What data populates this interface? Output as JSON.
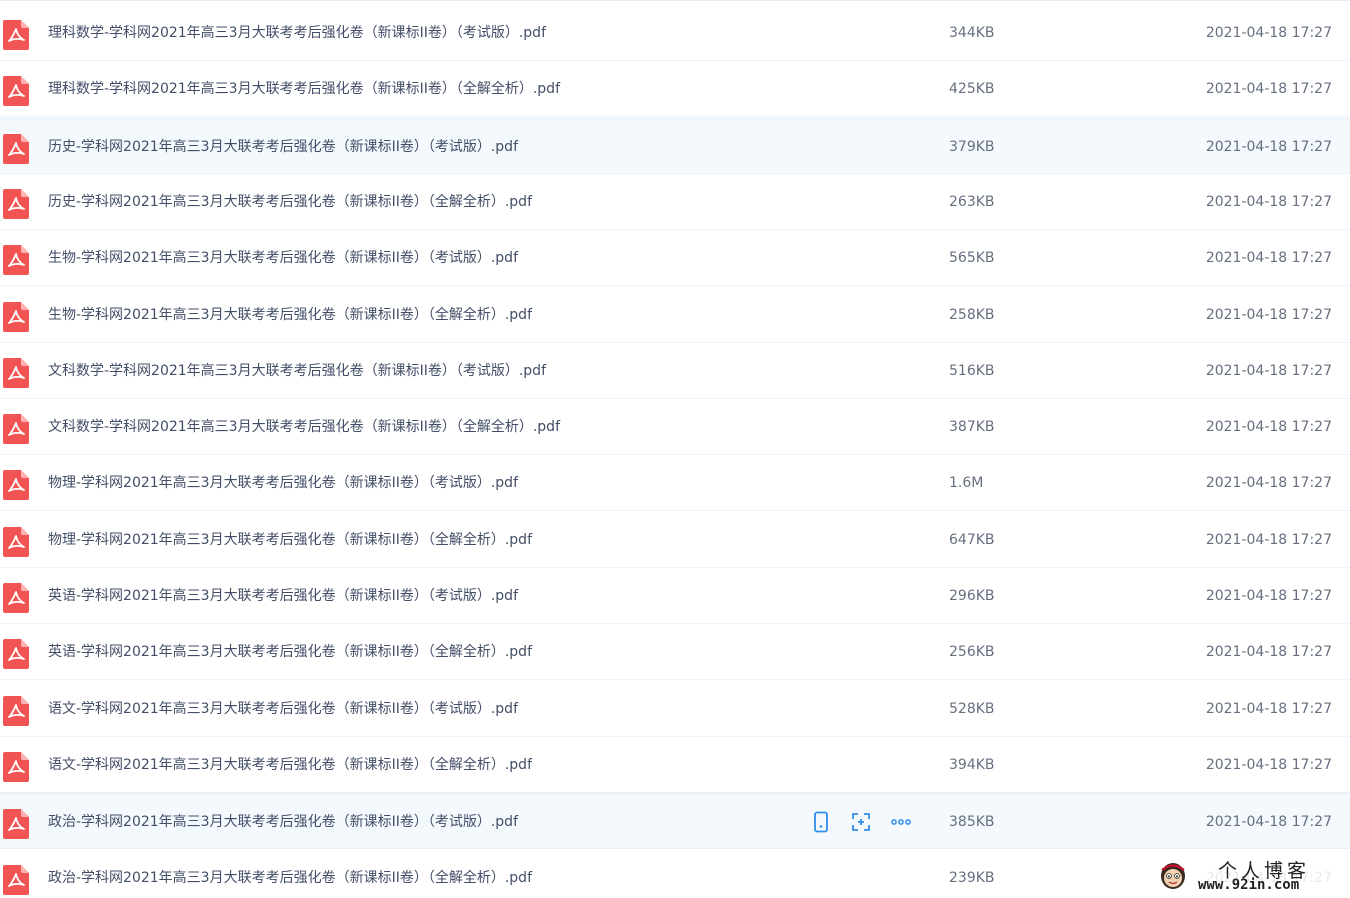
{
  "colors": {
    "pdf_icon": "#f25353",
    "row_highlight": "#f4f9fe",
    "action_icon": "#2f8ee8",
    "text_primary": "#424e67",
    "text_secondary": "#666f80"
  },
  "files": [
    {
      "name": "理科数学-学科网2021年高三3月大联考考后强化卷（新课标II卷）（考试版）.pdf",
      "size": "344KB",
      "date": "2021-04-18 17:27",
      "icon": "pdf-icon"
    },
    {
      "name": "理科数学-学科网2021年高三3月大联考考后强化卷（新课标II卷）（全解全析）.pdf",
      "size": "425KB",
      "date": "2021-04-18 17:27",
      "icon": "pdf-icon"
    },
    {
      "name": "历史-学科网2021年高三3月大联考考后强化卷（新课标II卷）（考试版）.pdf",
      "size": "379KB",
      "date": "2021-04-18 17:27",
      "icon": "pdf-icon"
    },
    {
      "name": "历史-学科网2021年高三3月大联考考后强化卷（新课标II卷）（全解全析）.pdf",
      "size": "263KB",
      "date": "2021-04-18 17:27",
      "icon": "pdf-icon"
    },
    {
      "name": "生物-学科网2021年高三3月大联考考后强化卷（新课标II卷）（考试版）.pdf",
      "size": "565KB",
      "date": "2021-04-18 17:27",
      "icon": "pdf-icon"
    },
    {
      "name": "生物-学科网2021年高三3月大联考考后强化卷（新课标II卷）（全解全析）.pdf",
      "size": "258KB",
      "date": "2021-04-18 17:27",
      "icon": "pdf-icon"
    },
    {
      "name": "文科数学-学科网2021年高三3月大联考考后强化卷（新课标II卷）（考试版）.pdf",
      "size": "516KB",
      "date": "2021-04-18 17:27",
      "icon": "pdf-icon"
    },
    {
      "name": "文科数学-学科网2021年高三3月大联考考后强化卷（新课标II卷）（全解全析）.pdf",
      "size": "387KB",
      "date": "2021-04-18 17:27",
      "icon": "pdf-icon"
    },
    {
      "name": "物理-学科网2021年高三3月大联考考后强化卷（新课标II卷）（考试版）.pdf",
      "size": "1.6M",
      "date": "2021-04-18 17:27",
      "icon": "pdf-icon"
    },
    {
      "name": "物理-学科网2021年高三3月大联考考后强化卷（新课标II卷）（全解全析）.pdf",
      "size": "647KB",
      "date": "2021-04-18 17:27",
      "icon": "pdf-icon"
    },
    {
      "name": "英语-学科网2021年高三3月大联考考后强化卷（新课标II卷）（考试版）.pdf",
      "size": "296KB",
      "date": "2021-04-18 17:27",
      "icon": "pdf-icon"
    },
    {
      "name": "英语-学科网2021年高三3月大联考考后强化卷（新课标II卷）（全解全析）.pdf",
      "size": "256KB",
      "date": "2021-04-18 17:27",
      "icon": "pdf-icon"
    },
    {
      "name": "语文-学科网2021年高三3月大联考考后强化卷（新课标II卷）（考试版）.pdf",
      "size": "528KB",
      "date": "2021-04-18 17:27",
      "icon": "pdf-icon"
    },
    {
      "name": "语文-学科网2021年高三3月大联考考后强化卷（新课标II卷）（全解全析）.pdf",
      "size": "394KB",
      "date": "2021-04-18 17:27",
      "icon": "pdf-icon"
    },
    {
      "name": "政治-学科网2021年高三3月大联考考后强化卷（新课标II卷）（考试版）.pdf",
      "size": "385KB",
      "date": "2021-04-18 17:27",
      "icon": "pdf-icon",
      "hovered": true,
      "actions": [
        "phone-icon",
        "share-link-icon",
        "more-icon"
      ]
    },
    {
      "name": "政治-学科网2021年高三3月大联考考后强化卷（新课标II卷）（全解全析）.pdf",
      "size": "239KB",
      "date": "2021-04-18 17:27",
      "icon": "pdf-icon"
    }
  ],
  "watermark": {
    "title": "个人博客",
    "url": "www.92in.com",
    "icon": "cartoon-avatar-icon"
  }
}
